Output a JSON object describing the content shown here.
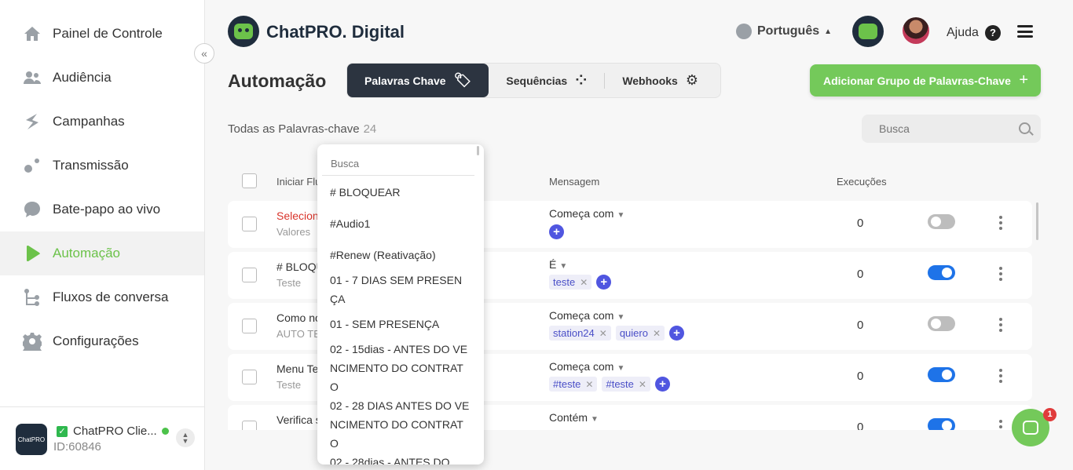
{
  "sidebar": {
    "items": [
      {
        "label": "Painel de Controle",
        "icon": "home-icon"
      },
      {
        "label": "Audiência",
        "icon": "users-icon"
      },
      {
        "label": "Campanhas",
        "icon": "campaign-icon"
      },
      {
        "label": "Transmissão",
        "icon": "broadcast-icon"
      },
      {
        "label": "Bate-papo ao vivo",
        "icon": "chat-bubble-icon"
      },
      {
        "label": "Automação",
        "icon": "play-icon"
      },
      {
        "label": "Fluxos de conversa",
        "icon": "flow-icon"
      },
      {
        "label": "Configurações",
        "icon": "gear-icon"
      }
    ],
    "collapse_label": "«",
    "account": {
      "logo_text": "ChatPRO",
      "name": "ChatPRO Clie...",
      "id": "ID:60846"
    }
  },
  "header": {
    "brand": "ChatPRO. Digital",
    "language": "Português",
    "help": "Ajuda"
  },
  "page": {
    "title": "Automação",
    "tabs": [
      {
        "label": "Palavras Chave",
        "icon": "tag-icon",
        "active": true
      },
      {
        "label": "Sequências",
        "icon": "sequence-icon",
        "active": false
      },
      {
        "label": "Webhooks",
        "icon": "webhook-icon",
        "active": false
      }
    ],
    "add_button": "Adicionar Grupo de Palavras-Chave",
    "count_label": "Todas as Palavras-chave",
    "count": "24",
    "search_placeholder": "Busca"
  },
  "table": {
    "headers": {
      "start": "Iniciar Flu",
      "message": "Mensagem",
      "executions": "Execuções"
    },
    "rows": [
      {
        "name": "Selecion",
        "sub": "Valores",
        "match": "Começa com",
        "chips": [],
        "exec": "0",
        "enabled": false
      },
      {
        "name": "# BLOQU",
        "sub": "Teste",
        "match": "É",
        "chips": [
          "teste"
        ],
        "exec": "0",
        "enabled": true
      },
      {
        "name": "Como no",
        "sub": "AUTO TE",
        "match": "Começa com",
        "chips": [
          "station24",
          "quiero"
        ],
        "exec": "0",
        "enabled": false
      },
      {
        "name": "Menu Te",
        "sub": "Teste",
        "match": "Começa com",
        "chips": [
          "#teste",
          "#teste"
        ],
        "exec": "0",
        "enabled": true
      },
      {
        "name": "Verifica s",
        "sub": "",
        "match": "Contém",
        "chips": [],
        "exec": "0",
        "enabled": true
      }
    ]
  },
  "dropdown": {
    "search_placeholder": "Busca",
    "items": [
      "# BLOQUEAR",
      "#Audio1",
      "#Renew (Reativação)",
      "01 - 7 DIAS SEM PRESENÇA",
      "01 - SEM PRESENÇA",
      "02 - 15dias - ANTES DO VENCIMENTO DO CONTRATO",
      "02 - 28 DIAS ANTES DO VENCIMENTO DO CONTRATO",
      "02 - 28dias - ANTES DO"
    ]
  },
  "chat_widget": {
    "badge": "1"
  },
  "colors": {
    "accent": "#6cc24a",
    "toggle_on": "#1e73e8",
    "dark": "#2c3440",
    "chip_add": "#5056e0"
  }
}
